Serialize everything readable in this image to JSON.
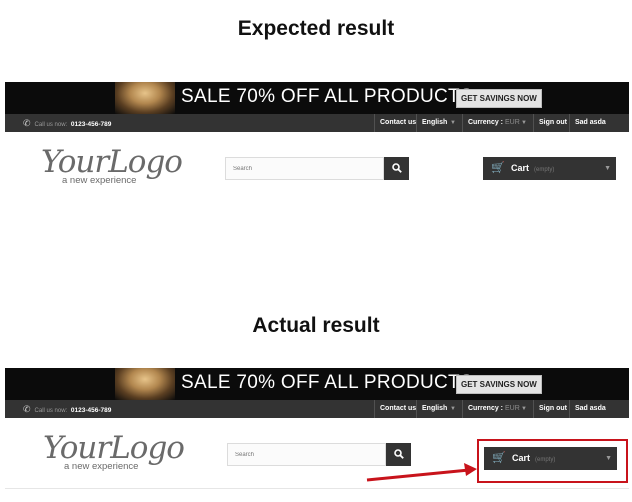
{
  "sections": [
    {
      "heading": "Expected result",
      "banner": {
        "sale_text": "SALE 70% OFF ALL PRODUCTS",
        "button_label": "GET SAVINGS NOW"
      },
      "topnav": {
        "call_label": "Call us now:",
        "phone": "0123-456-789",
        "contact": "Contact us",
        "language": "English",
        "currency_label": "Currency :",
        "currency_value": "EUR",
        "signout": "Sign out",
        "user": "Sad asda"
      },
      "logo": {
        "title": "YourLogo",
        "subtitle": "a new experience"
      },
      "search": {
        "placeholder": "Search"
      },
      "cart": {
        "label": "Cart",
        "status": "(empty)"
      }
    },
    {
      "heading": "Actual result",
      "banner": {
        "sale_text": "SALE 70% OFF ALL PRODUCTS",
        "button_label": "GET SAVINGS NOW"
      },
      "topnav": {
        "call_label": "Call us now:",
        "phone": "0123-456-789",
        "contact": "Contact us",
        "language": "English",
        "currency_label": "Currency :",
        "currency_value": "EUR",
        "signout": "Sign out",
        "user": "Sad asda"
      },
      "logo": {
        "title": "YourLogo",
        "subtitle": "a new experience"
      },
      "search": {
        "placeholder": "Search"
      },
      "cart": {
        "label": "Cart",
        "status": "(empty)"
      }
    }
  ],
  "colors": {
    "highlight": "#c8131b",
    "bar": "#333333",
    "banner": "#0b0b0b"
  },
  "icons": [
    "phone-icon",
    "search-icon",
    "cart-icon",
    "caret-down-icon"
  ]
}
